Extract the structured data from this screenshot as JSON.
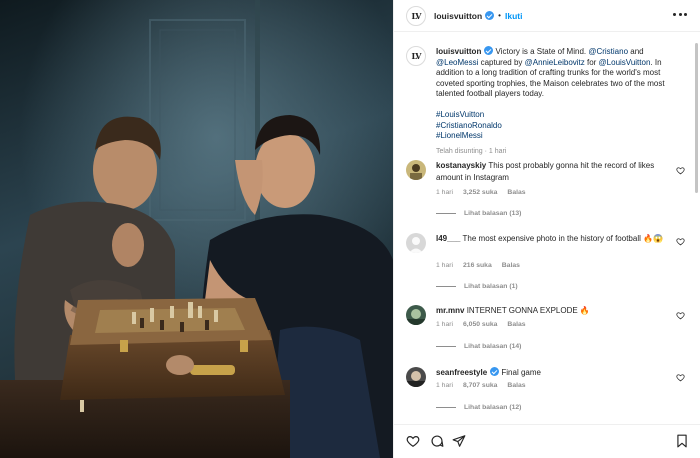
{
  "header": {
    "username": "louisvuitton",
    "logo": "LV",
    "separator": "•",
    "follow_label": "Ikuti"
  },
  "caption": {
    "username": "louisvuitton",
    "t1": " Victory is a State of Mind. ",
    "m1": "@Cristiano",
    "t2": " and ",
    "m2": "@LeoMessi",
    "t3": " captured by ",
    "m3": "@AnnieLeibovitz",
    "t4": " for ",
    "m4": "@LouisVuitton",
    "t5": ". In addition to a long tradition of crafting trunks for the world's most coveted sporting trophies, the Maison celebrates two of the most talented football players today.",
    "hashtags": [
      "#LouisVuitton",
      "#CristianoRonaldo",
      "#LionelMessi"
    ],
    "edited": "Telah disunting · 1 hari"
  },
  "comments": [
    {
      "username": "kostanayskiy",
      "text": "This post probably gonna hit the record of likes amount in Instagram",
      "time": "1 hari",
      "likes": "3,252 suka",
      "reply": "Balas",
      "replies": "Lihat balasan (13)",
      "avatar_color": "#c9b77a"
    },
    {
      "username": "l49___",
      "text": "The most expensive photo in the history of football 🔥😱",
      "time": "1 hari",
      "likes": "216 suka",
      "reply": "Balas",
      "replies": "Lihat balasan (1)",
      "avatar_color": "#d8d8d8"
    },
    {
      "username": "mr.mnv",
      "text": "INTERNET GONNA EXPLODE 🔥",
      "time": "1 hari",
      "likes": "6,050 suka",
      "reply": "Balas",
      "replies": "Lihat balasan (14)",
      "avatar_color": "#3d5a4a"
    },
    {
      "username": "seanfreestyle",
      "text": "Final game",
      "time": "1 hari",
      "likes": "8,707 suka",
      "reply": "Balas",
      "replies": "Lihat balasan (12)",
      "avatar_color": "#4a4a4a"
    }
  ],
  "icons": {
    "like": "heart-icon",
    "comment": "comment-icon",
    "share": "share-icon",
    "save": "bookmark-icon",
    "more": "more-options-icon",
    "verified": "verified-badge-icon"
  },
  "colors": {
    "accent": "#0095f6",
    "mention": "#00376b",
    "verified": "#3897f0",
    "muted": "#8e8e8e"
  }
}
